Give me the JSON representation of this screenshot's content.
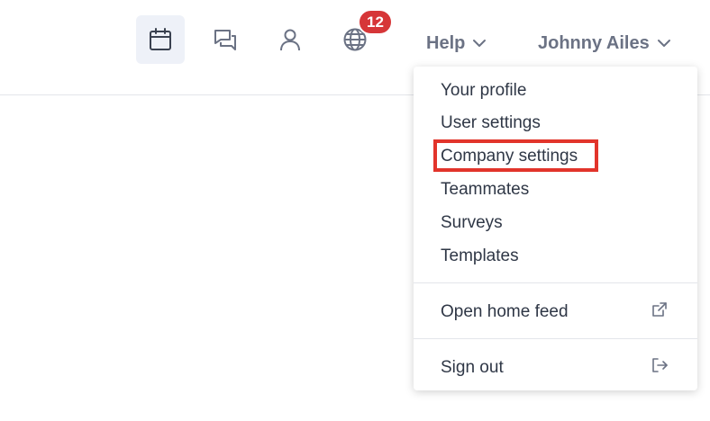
{
  "toolbar": {
    "notifications_count": "12",
    "help_label": "Help",
    "user_name": "Johnny Ailes",
    "icons": [
      "calendar-icon",
      "chat-icon",
      "person-icon",
      "globe-icon",
      "chevron-down-icon"
    ]
  },
  "menu": {
    "items": [
      {
        "label": "Your profile"
      },
      {
        "label": "User settings"
      },
      {
        "label": "Company settings"
      },
      {
        "label": "Teammates"
      },
      {
        "label": "Surveys"
      },
      {
        "label": "Templates"
      }
    ],
    "open_home_feed": "Open home feed",
    "sign_out": "Sign out"
  },
  "colors": {
    "highlight": "#e2342b",
    "badge": "#d63638",
    "active_bg": "#eef1f8"
  }
}
